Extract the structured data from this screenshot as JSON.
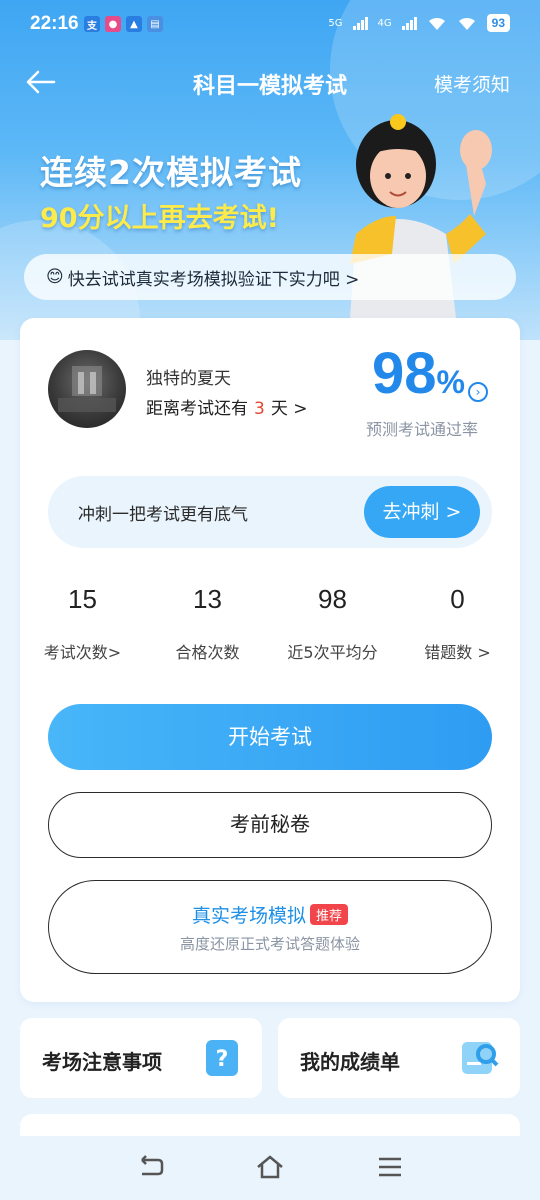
{
  "status_bar": {
    "time": "22:16",
    "battery": "93",
    "network_1": "5G",
    "network_2": "4G"
  },
  "header": {
    "title": "科目一模拟考试",
    "notice_link": "模考须知"
  },
  "banner": {
    "line1": "连续2次模拟考试",
    "line2": "90分以上再去考试!",
    "tip": "快去试试真实考场模拟验证下实力吧 >",
    "tip_emoji": "😊"
  },
  "profile": {
    "name": "独特的夏天",
    "countdown_prefix": "距离考试还有",
    "countdown_days": "3",
    "countdown_suffix": "天 >",
    "pass_rate_value": "98",
    "pass_rate_unit": "%",
    "pass_rate_label": "预测考试通过率"
  },
  "sprint": {
    "text": "冲刺一把考试更有底气",
    "button": "去冲刺 >"
  },
  "stats": [
    {
      "value": "15",
      "label": "考试次数>"
    },
    {
      "value": "13",
      "label": "合格次数"
    },
    {
      "value": "98",
      "label": "近5次平均分"
    },
    {
      "value": "0",
      "label": "错题数 >"
    }
  ],
  "actions": {
    "start": "开始考试",
    "secret": "考前秘卷",
    "real_title": "真实考场模拟",
    "real_badge": "推荐",
    "real_sub": "高度还原正式考试答题体验"
  },
  "tiles": [
    {
      "label": "考场注意事项",
      "icon": "question-card-icon"
    },
    {
      "label": "我的成绩单",
      "icon": "search-report-icon"
    }
  ],
  "colors": {
    "accent": "#2289ea",
    "highlight_yellow": "#fdea4b",
    "danger": "#e2462f"
  }
}
